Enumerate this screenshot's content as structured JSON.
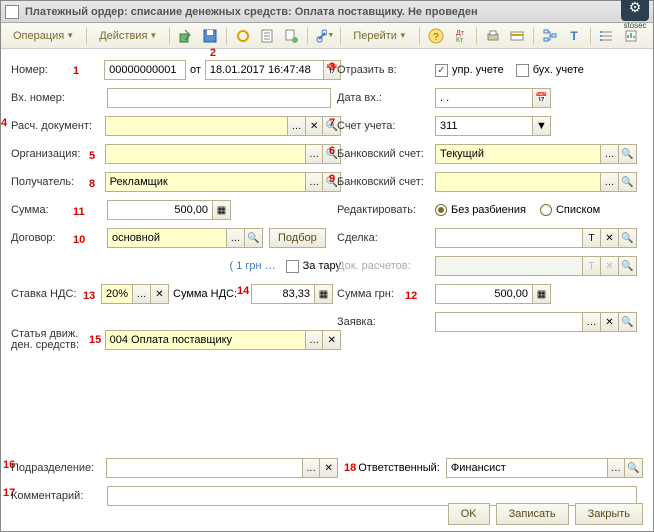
{
  "window": {
    "title": "Платежный ордер: списание денежных средств: Оплата поставщику. Не проведен",
    "brand": "stosec"
  },
  "toolbar": {
    "operation": "Операция",
    "actions": "Действия",
    "goto": "Перейти"
  },
  "left": {
    "number_label": "Номер:",
    "number": "00000000001",
    "from": "от",
    "date": "18.01.2017 16:47:48",
    "inc_number_label": "Вх. номер:",
    "doc_label": "Расч. документ:",
    "org_label": "Организация:",
    "payee_label": "Получатель:",
    "payee": "Рекламщик",
    "sum_label": "Сумма:",
    "sum": "500,00",
    "contract_label": "Договор:",
    "contract": "основной",
    "podbor": "Подбор",
    "rate_note": "( 1 грн …",
    "tare": "За тару",
    "vat_rate_label": "Ставка НДС:",
    "vat_rate": "20%",
    "vat_sum_label": "Сумма НДС:",
    "vat_sum": "83,33",
    "article_label1": "Статья движ.",
    "article_label2": "ден. средств:",
    "article": "004 Оплата поставщику",
    "subdiv_label": "Подразделение:",
    "comment_label": "Комментарий:"
  },
  "right": {
    "reflect_label": "Отразить в:",
    "upr": "упр. учете",
    "buh": "бух. учете",
    "date_in_label": "Дата вх.:",
    "date_in": ". .",
    "account_label": "Счет учета:",
    "account": "311",
    "bank1_label": "Банковский счет:",
    "bank1": "Текущий",
    "bank2_label": "Банковский счет:",
    "edit_label": "Редактировать:",
    "edit_opt1": "Без разбиения",
    "edit_opt2": "Списком",
    "deal_label": "Сделка:",
    "doccalc_label": "Док. расчетов:",
    "sum_grn_label": "Сумма грн:",
    "sum_grn": "500,00",
    "request_label": "Заявка:",
    "resp_label": "Ответственный:",
    "resp": "Финансист"
  },
  "annotations": {
    "a1": "1",
    "a2": "2",
    "a3": "3",
    "a4": "4",
    "a5": "5",
    "a6": "6",
    "a7": "7",
    "a8": "8",
    "a9": "9",
    "a10": "10",
    "a11": "11",
    "a12": "12",
    "a13": "13",
    "a14": "14",
    "a15": "15",
    "a16": "16",
    "a17": "17",
    "a18": "18"
  },
  "footer": {
    "ok": "OK",
    "write": "Записать",
    "close": "Закрыть"
  }
}
